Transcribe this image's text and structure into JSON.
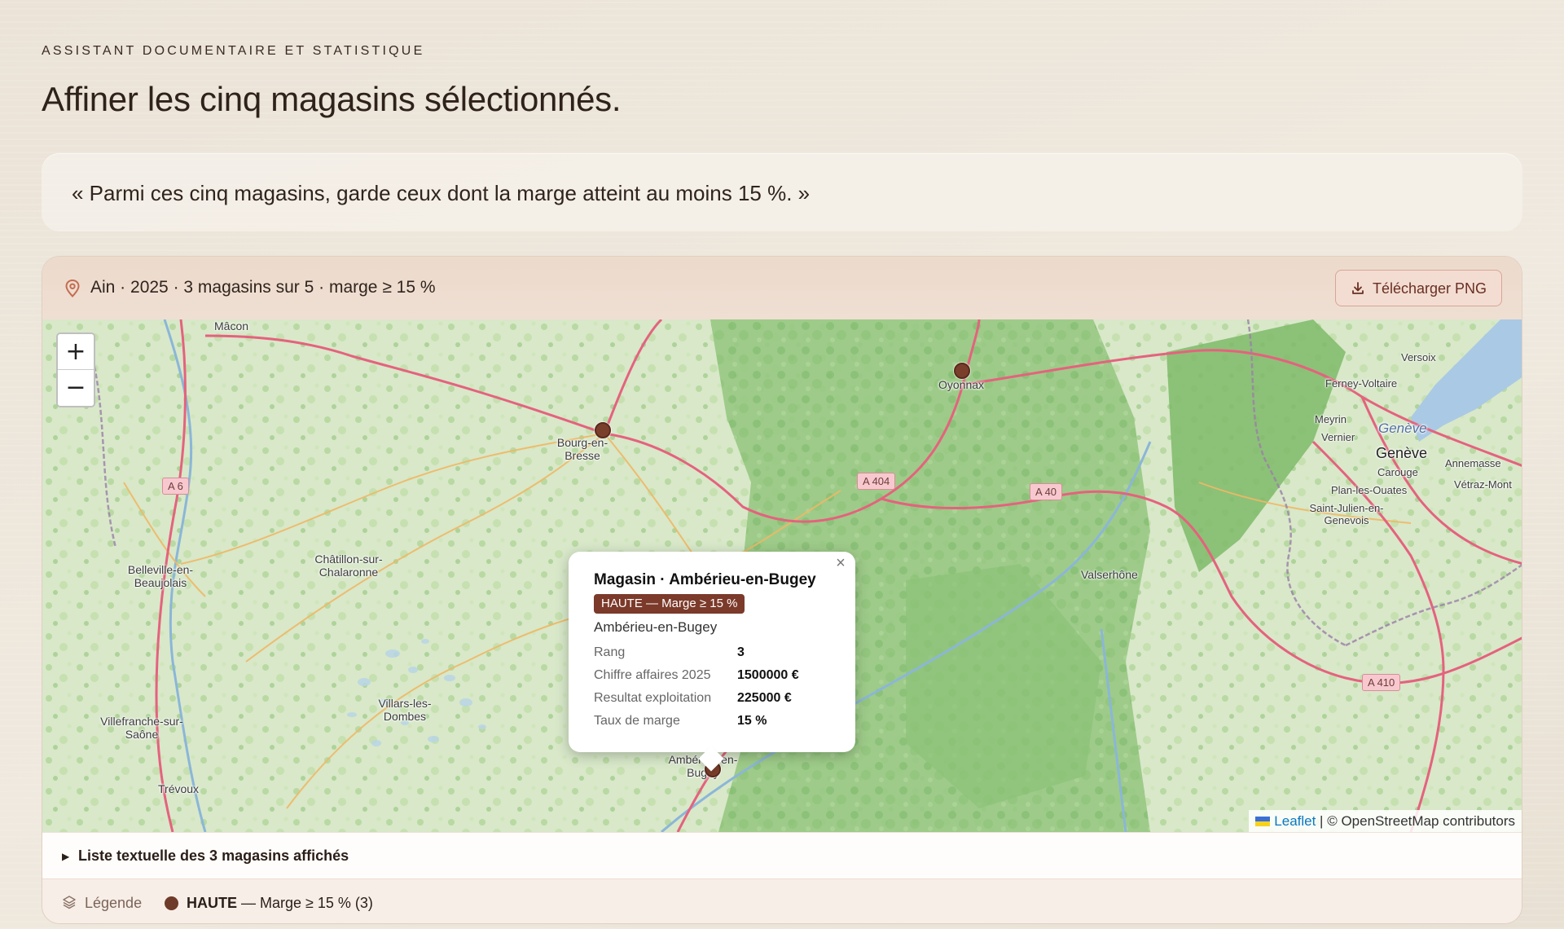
{
  "header": {
    "kicker": "ASSISTANT DOCUMENTAIRE ET STATISTIQUE",
    "title": "Affiner les cinq magasins sélectionnés."
  },
  "query": {
    "text": "« Parmi ces cinq magasins, garde ceux dont la marge atteint au moins 15 %. »"
  },
  "map_card": {
    "caption": "Ain · 2025 · 3 magasins sur 5 · marge ≥ 15 %",
    "download_label": "Télécharger PNG",
    "zoom_in": "+",
    "zoom_out": "−",
    "attribution_leaflet": "Leaflet",
    "attribution_rest": " | © OpenStreetMap contributors",
    "places": {
      "macon": "Mâcon",
      "bourg": "Bourg-en-Bresse",
      "oyonnax": "Oyonnax",
      "chatillon": "Châtillon-sur-Chalaronne",
      "belleville": "Belleville-en-Beaujolais",
      "villars": "Villars-les-Dombes",
      "villefranche": "Villefranche-sur-Saône",
      "trevoux": "Trévoux",
      "amberieu": "Ambérieu-en-Bugey",
      "valserhone": "Valserhône",
      "versoix": "Versoix",
      "ferney": "Ferney-Voltaire",
      "meyrin": "Meyrin",
      "vernier": "Vernier",
      "geneve_lake": "Genève",
      "geneve": "Genève",
      "annemasse": "Annemasse",
      "carouge": "Carouge",
      "plan": "Plan-les-Ouates",
      "vetraz": "Vétraz-Mont",
      "saintjulien": "Saint-Julien-en-Genevois"
    },
    "roads": {
      "a6": "A 6",
      "a404": "A 404",
      "a40": "A 40",
      "a410": "A 410"
    },
    "popup": {
      "title": "Magasin · Ambérieu-en-Bugey",
      "badge": "HAUTE — Marge ≥ 15 %",
      "subtitle": "Ambérieu-en-Bugey",
      "rows": [
        {
          "key": "Rang",
          "value": "3"
        },
        {
          "key": "Chiffre affaires 2025",
          "value": "1500000 €"
        },
        {
          "key": "Resultat exploitation",
          "value": "225000 €"
        },
        {
          "key": "Taux de marge",
          "value": "15 %"
        }
      ],
      "close": "×"
    },
    "list_toggle": "Liste textuelle des 3 magasins affichés",
    "legend": {
      "label": "Légende",
      "class_name": "HAUTE",
      "class_rest": " — Marge ≥ 15 % (3)",
      "color": "#6e3a29"
    }
  }
}
